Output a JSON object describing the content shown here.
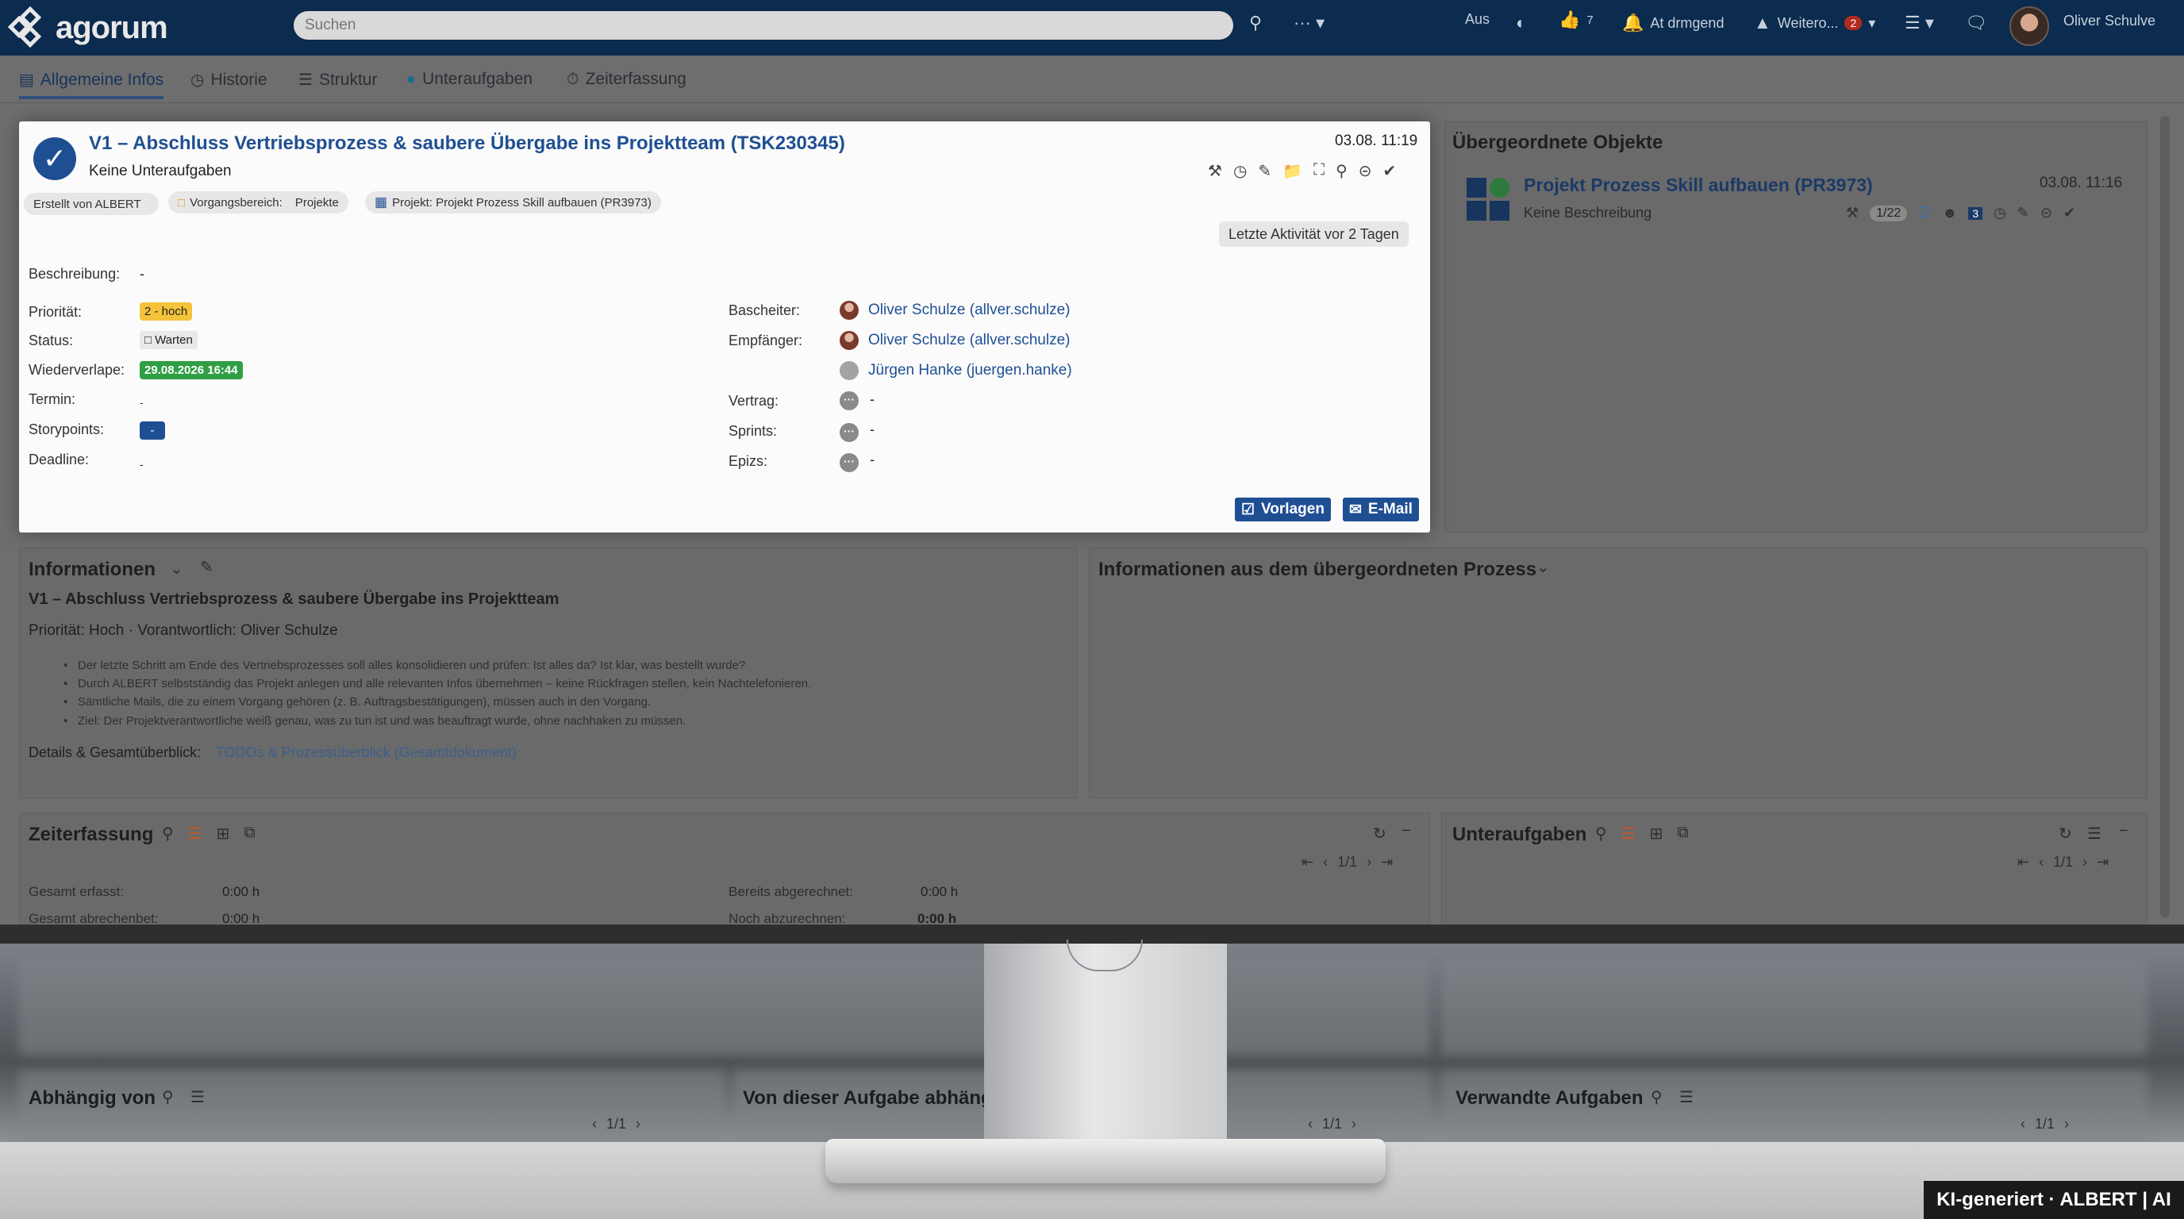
{
  "topbar": {
    "logo": "agorum",
    "search_placeholder": "Suchen",
    "status_label": "Aus",
    "likes_count": "7",
    "notification_label": "At drmgend",
    "further_label": "Weitero...",
    "further_badge": "2",
    "user_name": "Oliver Schulve"
  },
  "tabs": [
    {
      "label": "Allgemeine Infos",
      "icon": "list-icon"
    },
    {
      "label": "Historie",
      "icon": "clock-icon"
    },
    {
      "label": "Struktur",
      "icon": "structure-icon"
    },
    {
      "label": "Unteraufgaben",
      "icon": "subtask-icon"
    },
    {
      "label": "Zeiterfassung",
      "icon": "stopwatch-icon"
    }
  ],
  "task": {
    "title": "V1 – Abschluss Vertriebsprozess & saubere Übergabe ins Projektteam (TSK230345)",
    "subtitle": "Keine Unteraufgaben",
    "date": "03.08. 11:19",
    "created_by": "Erstellt von ALBERT",
    "area_label": "Vorgangsbereich:",
    "area_value": "Projekte",
    "project_pill": "Projekt: Projekt Prozess Skill aufbauen (PR3973)",
    "activity": "Letzte Aktivität vor 2 Tagen",
    "description_label": "Beschreibung:",
    "description_value": "-",
    "fields_left": {
      "priority_label": "Priorität:",
      "priority_value": "2 - hoch",
      "status_label": "Status:",
      "status_value": "Warten",
      "resubmission_label": "Wiederverlape:",
      "resubmission_value": "29.08.2026 16:44",
      "due_label": "Termin:",
      "due_value": "-",
      "storypoints_label": "Storypoints:",
      "storypoints_value": "-",
      "deadline_label": "Deadline:",
      "deadline_value": "-"
    },
    "fields_right": {
      "editor_label": "Bascheiter:",
      "editor_value": "Oliver Schulze (allver.schulze)",
      "recipients_label": "Empfänger:",
      "recipient_1": "Oliver Schulze (allver.schulze)",
      "recipient_2": "Jürgen Hanke (juergen.hanke)",
      "contract_label": "Vertrag:",
      "contract_value": "-",
      "sprints_label": "Sprints:",
      "sprints_value": "-",
      "epics_label": "Epizs:",
      "epics_value": "-"
    },
    "btn_templates": "Vorlagen",
    "btn_email": "E-Mail"
  },
  "parent": {
    "heading": "Übergeordnete Objekte",
    "title": "Projekt Prozess Skill aufbauen (PR3973)",
    "subtitle": "Keine Beschreibung",
    "date": "03.08. 11:16",
    "count": "1/22",
    "badge": "3"
  },
  "info": {
    "heading": "Informationen",
    "title": "V1 – Abschluss Vertriebsprozess & saubere Übergabe ins Projektteam",
    "meta": "Priorität: Hoch · Vorantwortlich: Oliver Schulze",
    "bullets": [
      "Der letzte Schritt am Ende des Vertriebsprozesses soll alles konsolidieren und prüfen: Ist alles da? Ist klar, was bestellt wurde?",
      "Durch ALBERT selbstständig das Projekt anlegen und alle relevanten Infos übernehmen – keine Rückfragen stellen, kein Nachtelefonieren.",
      "Sämtliche Mails, die zu einem Vorgang gehören (z. B. Auftragsbestätigungen), müssen auch in den Vorgang.",
      "Ziel: Der Projektverantwortliche weiß genau, was zu tun ist und was beauftragt wurde, ohne nachhaken zu müssen."
    ],
    "details_label": "Details & Gesamtüberblick:",
    "details_link": "TODOs & Prozessüberblick (Gesamtdokument)",
    "parent_info_heading": "Informationen aus dem übergeordneten Prozess"
  },
  "timetracking": {
    "heading": "Zeiterfassung",
    "pagination": "1/1",
    "total_label": "Gesamt erfasst:",
    "total_value": "0:00 h",
    "billable_label": "Gesamt abrechenbet:",
    "billable_value": "0:00 h",
    "billed_label": "Bereits abgerechnet:",
    "billed_value": "0:00 h",
    "unbilled_label": "Noch abzurechnen:",
    "unbilled_value": "0:00 h"
  },
  "subtasks": {
    "heading": "Unteraufgaben",
    "pagination": "1/1"
  },
  "bottom_panels": [
    {
      "heading": "Abhängig von",
      "pagination": "1/1"
    },
    {
      "heading": "Von dieser Aufgabe abhäng",
      "pagination": "1/1"
    },
    {
      "heading": "Verwandte Aufgaben",
      "pagination": "1/1"
    }
  ],
  "watermark": "KI-generiert · ALBERT | AI",
  "colors": {
    "topbar": "#0b2b4f",
    "accent": "#1f4f93",
    "priority_tag": "#f4c33b",
    "resubmission_tag": "#2f9e44",
    "overlay": "#6e6e6e"
  }
}
